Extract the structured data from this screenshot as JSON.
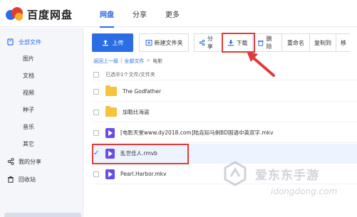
{
  "header": {
    "logo_text": "百度网盘",
    "nav": [
      {
        "label": "网盘",
        "active": true
      },
      {
        "label": "分享",
        "active": false
      },
      {
        "label": "更多",
        "active": false
      }
    ]
  },
  "sidebar": {
    "items": [
      {
        "label": "全部文件",
        "icon": "folder-icon",
        "level": "main",
        "active": true
      },
      {
        "label": "图片",
        "level": "sub"
      },
      {
        "label": "文档",
        "level": "sub"
      },
      {
        "label": "视频",
        "level": "sub"
      },
      {
        "label": "种子",
        "level": "sub"
      },
      {
        "label": "音乐",
        "level": "sub"
      },
      {
        "label": "其它",
        "level": "sub"
      },
      {
        "label": "我的分享",
        "icon": "share-icon",
        "level": "main"
      },
      {
        "label": "回收站",
        "icon": "trash-icon",
        "level": "main"
      }
    ]
  },
  "toolbar": {
    "upload": "上传",
    "new_folder": "新建文件夹",
    "share": "分享",
    "download": "下载",
    "delete": "删除",
    "rename": "重命名",
    "copy_to": "复制到",
    "move": "移"
  },
  "breadcrumb": {
    "back": "返回上一级",
    "sep": "|",
    "all_files": "全部文件",
    "arrow": ">",
    "current": "电影"
  },
  "list": {
    "selection_status": "已选中1个文件/文件夹",
    "rows": [
      {
        "name": "The Godfather",
        "type": "folder",
        "selected": false
      },
      {
        "name": "加勒比海盗",
        "type": "folder",
        "selected": false
      },
      {
        "name": "[电影天堂www.dy2018.com]陆垚知马俐BD国语中英双字.mkv",
        "type": "video",
        "selected": false
      },
      {
        "name": "乱世佳人.rmvb",
        "type": "video",
        "selected": true
      },
      {
        "name": "Pearl.Harbor.mkv",
        "type": "video",
        "selected": false
      }
    ]
  },
  "watermark": {
    "title": "爱东东手游",
    "url": "idongdong.com"
  },
  "colors": {
    "accent": "#2b6de5",
    "highlight": "#e23a3a",
    "folder": "#f7c33c",
    "video": "#6a4ce5"
  }
}
